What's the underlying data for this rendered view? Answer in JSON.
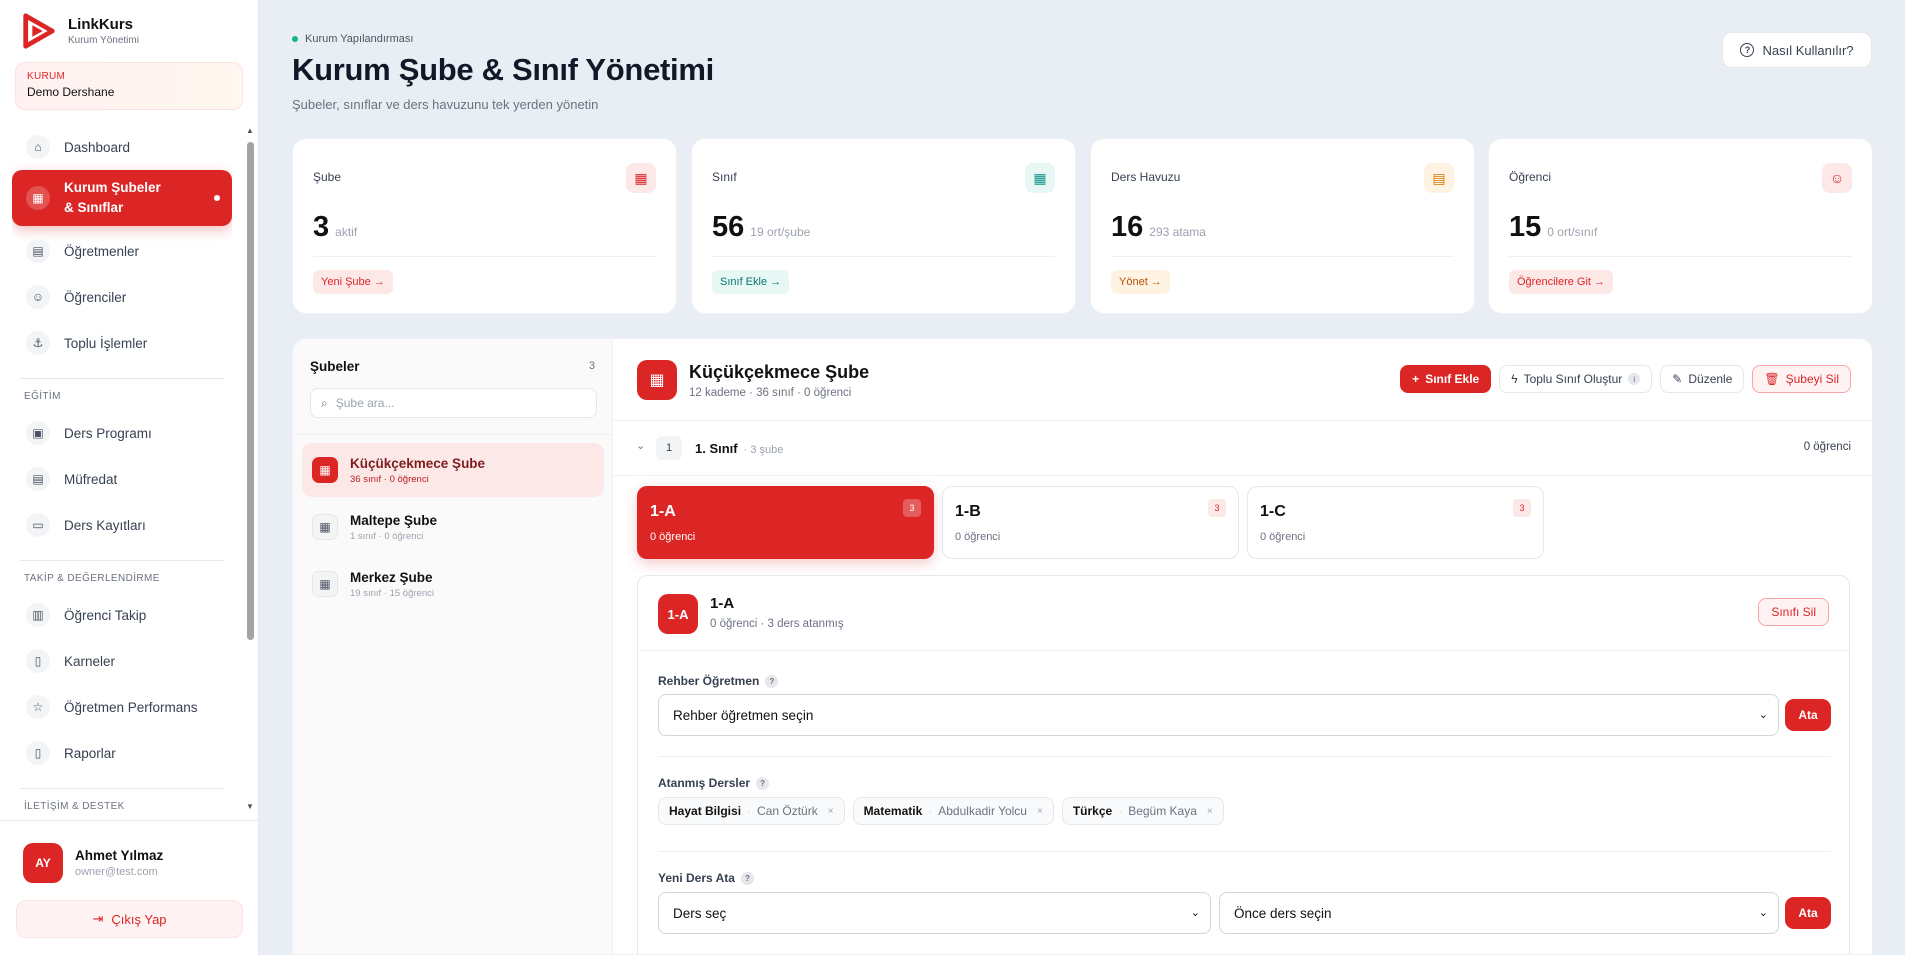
{
  "app": {
    "name": "LinkKurs",
    "subtitle": "Kurum Yönetimi"
  },
  "org": {
    "label": "KURUM",
    "name": "Demo Dershane"
  },
  "nav": {
    "items_main": [
      {
        "label": "Dashboard",
        "icon": "home-icon"
      },
      {
        "label": "Kurum Şubeler & Sınıflar",
        "icon": "building-icon",
        "active": true
      },
      {
        "label": "Öğretmenler",
        "icon": "book-open-icon"
      },
      {
        "label": "Öğrenciler",
        "icon": "users-icon"
      },
      {
        "label": "Toplu İşlemler",
        "icon": "anchor-icon"
      }
    ],
    "section_education": "EĞİTİM",
    "items_education": [
      {
        "label": "Ders Programı",
        "icon": "calendar-icon"
      },
      {
        "label": "Müfredat",
        "icon": "book-icon"
      },
      {
        "label": "Ders Kayıtları",
        "icon": "video-icon"
      }
    ],
    "section_tracking": "TAKİP & DEĞERLENDİRME",
    "items_tracking": [
      {
        "label": "Öğrenci Takip",
        "icon": "bar-chart-icon"
      },
      {
        "label": "Karneler",
        "icon": "file-icon"
      },
      {
        "label": "Öğretmen Performans",
        "icon": "star-icon"
      },
      {
        "label": "Raporlar",
        "icon": "report-icon"
      }
    ],
    "section_comm": "İLETİŞİM & DESTEK"
  },
  "user": {
    "initials": "AY",
    "name": "Ahmet Yılmaz",
    "email": "owner@test.com"
  },
  "logout_label": "Çıkış Yap",
  "header": {
    "breadcrumb": "Kurum Yapılandırması",
    "title": "Kurum Şube & Sınıf Yönetimi",
    "subtitle": "Şubeler, sınıflar ve ders havuzunu tek yerden yönetin",
    "help_label": "Nasıl Kullanılır?"
  },
  "stats": [
    {
      "label": "Şube",
      "value": "3",
      "note": "aktif",
      "link": "Yeni Şube →",
      "color": "#dc2626",
      "bg": "#fde8e8",
      "icon": "building-icon"
    },
    {
      "label": "Sınıf",
      "value": "56",
      "note": "19 ort/şube",
      "link": "Sınıf Ekle →",
      "color": "#0d9488",
      "bg": "#e6f7f4",
      "icon": "grid-icon"
    },
    {
      "label": "Ders Havuzu",
      "value": "16",
      "note": "293 atama",
      "link": "Yönet →",
      "color": "#d97706",
      "bg": "#fef3e2",
      "icon": "book-open-icon"
    },
    {
      "label": "Öğrenci",
      "value": "15",
      "note": "0 ort/sınıf",
      "link": "Öğrencilere Git →",
      "color": "#dc2626",
      "bg": "#fde8e8",
      "icon": "users-icon"
    }
  ],
  "branches": {
    "title": "Şubeler",
    "count": "3",
    "search_placeholder": "Şube ara...",
    "items": [
      {
        "name": "Küçükçekmece Şube",
        "meta": "36 sınıf · 0 öğrenci",
        "active": true
      },
      {
        "name": "Maltepe Şube",
        "meta": "1 sınıf · 0 öğrenci"
      },
      {
        "name": "Merkez Şube",
        "meta": "19 sınıf · 15 öğrenci"
      }
    ]
  },
  "detail": {
    "name": "Küçükçekmece Şube",
    "meta": "12 kademe · 36 sınıf · 0 öğrenci",
    "btn_add_class": "Sınıf Ekle",
    "btn_bulk": "Toplu Sınıf Oluştur",
    "btn_edit": "Düzenle",
    "btn_delete": "Şubeyi Sil",
    "grade": {
      "num": "1",
      "label": "1. Sınıf",
      "sub": "· 3 şube",
      "students": "0 öğrenci"
    },
    "classes": [
      {
        "name": "1-A",
        "sub": "0 öğrenci",
        "badge": "3",
        "active": true
      },
      {
        "name": "1-B",
        "sub": "0 öğrenci",
        "badge": "3"
      },
      {
        "name": "1-C",
        "sub": "0 öğrenci",
        "badge": "3"
      }
    ],
    "selected": {
      "code": "1-A",
      "name": "1-A",
      "meta": "0 öğrenci · 3 ders atanmış",
      "delete_label": "Sınıfı Sil",
      "guide_label": "Rehber Öğretmen",
      "guide_placeholder": "Rehber öğretmen seçin",
      "assign_label": "Ata",
      "courses_label": "Atanmış Dersler",
      "courses": [
        {
          "subject": "Hayat Bilgisi",
          "teacher": "Can Öztürk"
        },
        {
          "subject": "Matematik",
          "teacher": "Abdulkadir Yolcu"
        },
        {
          "subject": "Türkçe",
          "teacher": "Begüm Kaya"
        }
      ],
      "new_course_label": "Yeni Ders Ata",
      "course_select": "Ders seç",
      "teacher_select": "Önce ders seçin"
    }
  }
}
